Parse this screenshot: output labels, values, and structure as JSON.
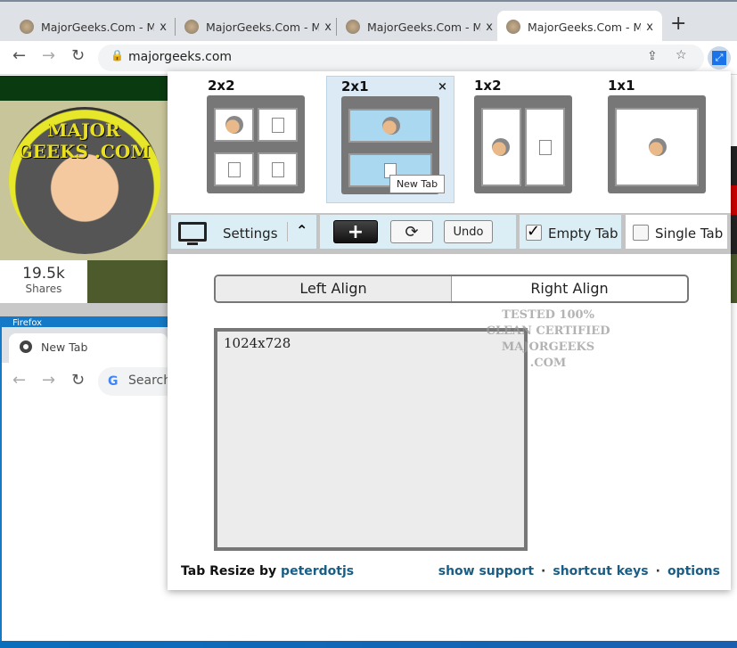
{
  "browser": {
    "tabs": [
      {
        "title": "MajorGeeks.Com - M"
      },
      {
        "title": "MajorGeeks.Com - M"
      },
      {
        "title": "MajorGeeks.Com - M"
      },
      {
        "title": "MajorGeeks.Com - M"
      }
    ],
    "close": "x",
    "new_tab": "+",
    "url": "majorgeeks.com"
  },
  "page": {
    "logo_text": "MAJOR GEEKS .COM",
    "shares_count": "19.5k",
    "shares_label": "Shares",
    "firefox_label": "Firefox",
    "second_window": {
      "tab_title": "New Tab",
      "search_placeholder": "Search"
    }
  },
  "popup": {
    "layouts": [
      {
        "label": "2x2"
      },
      {
        "label": "2x1",
        "selected": true
      },
      {
        "label": "1x2"
      },
      {
        "label": "1x1"
      }
    ],
    "tooltip": "New Tab",
    "close": "×",
    "settings_label": "Settings",
    "add": "+",
    "refresh": "⟳",
    "undo": "Undo",
    "empty_tab": {
      "label": "Empty Tab",
      "checked": true
    },
    "single_tab": {
      "label": "Single Tab",
      "checked": false
    },
    "align": {
      "left": "Left Align",
      "right": "Right Align",
      "selected": "left"
    },
    "preview_size": "1024x728",
    "watermark": "TESTED 100% CLEAN CERTIFIED MAJORGEEKS .COM",
    "footer": {
      "brand": "Tab Resize by",
      "author": "peterdotjs",
      "links": [
        "show support",
        "shortcut keys",
        "options"
      ],
      "separator": "·"
    }
  }
}
